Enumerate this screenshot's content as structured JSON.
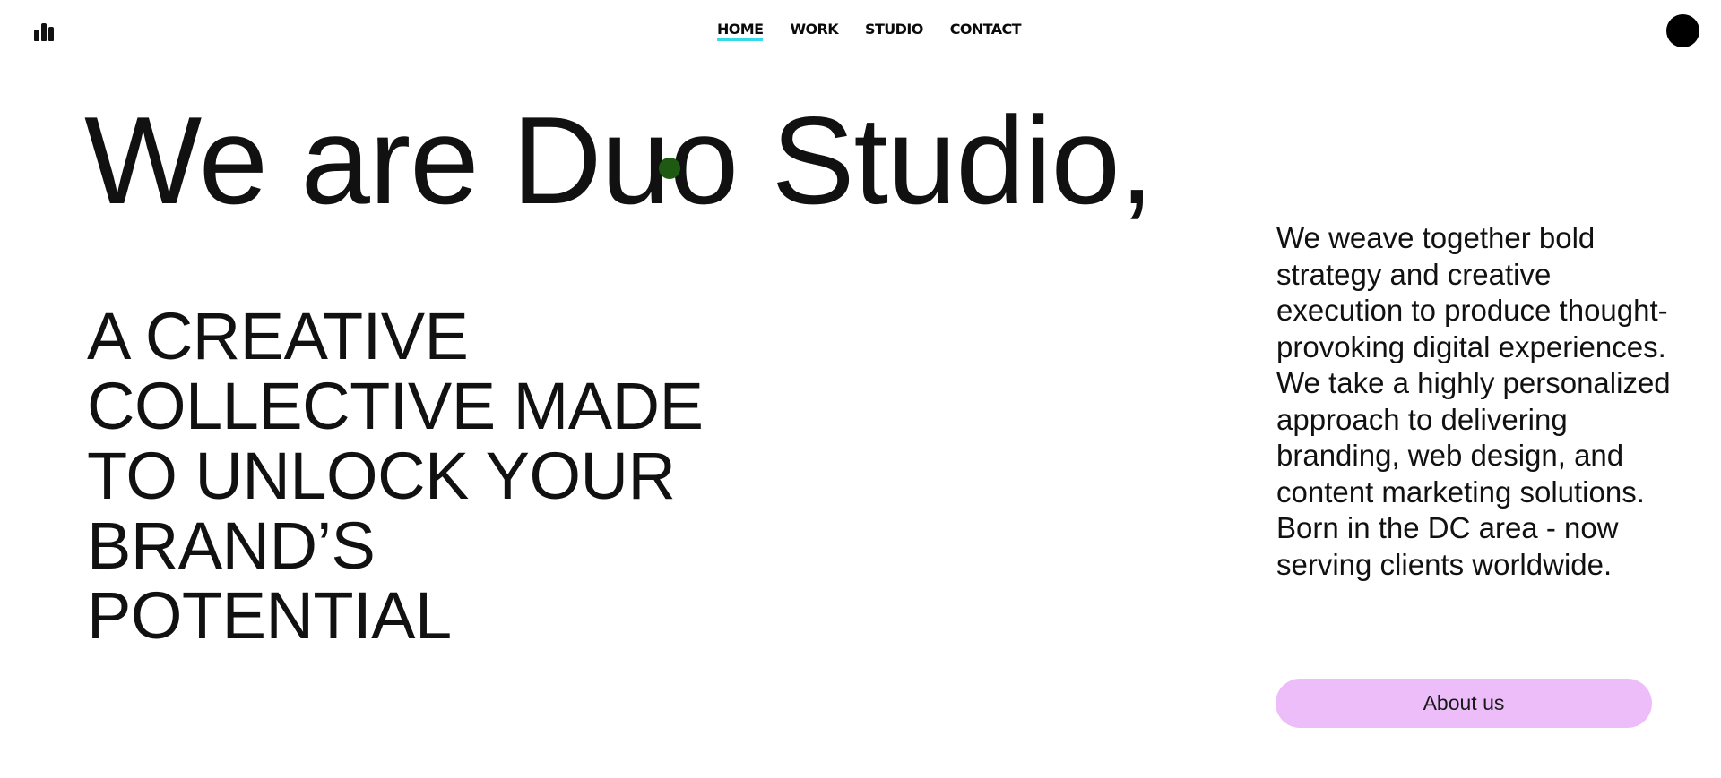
{
  "header": {
    "logo_icon": "bar-chart-logo-icon",
    "nav": [
      {
        "label": "HOME",
        "active": true
      },
      {
        "label": "WORK",
        "active": false
      },
      {
        "label": "STUDIO",
        "active": false
      },
      {
        "label": "CONTACT",
        "active": false
      }
    ],
    "active_underline_color": "#35d9e8",
    "profile_icon": "profile-dot-icon"
  },
  "hero": {
    "title": "We are Duo Studio,",
    "tagline": "A CREATIVE COLLECTIVE MADE TO UNLOCK YOUR BRAND’S POTENTIAL",
    "cursor_color": "#1f5a12"
  },
  "intro": {
    "text": "We weave together bold strategy and creative execution to produce thought-provoking digital experiences. We take a highly personalized approach to delivering branding, web design, and content marketing solutions. Born in the DC area - now serving clients worldwide.",
    "button_label": "About us",
    "button_color": "#ecbdf9"
  }
}
